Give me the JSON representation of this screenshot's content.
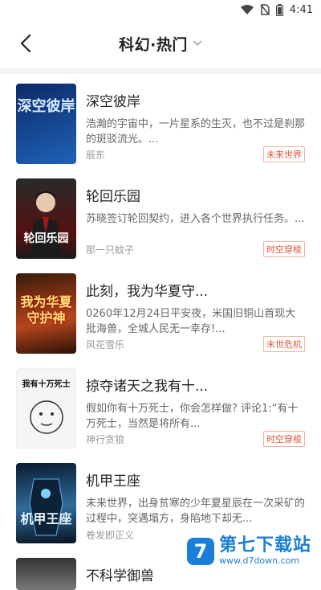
{
  "status": {
    "time": "4:41"
  },
  "header": {
    "title": "科幻·热门"
  },
  "books": [
    {
      "title": "深空彼岸",
      "desc": "浩瀚的宇宙中，一片星系的生灭，也不过是刹那的斑驳流光。...",
      "author": "辰东",
      "tag": "未来世界",
      "cover_text": "深空彼岸",
      "cover_colors": [
        "#0c2a66",
        "#1f62b8"
      ]
    },
    {
      "title": "轮回乐园",
      "desc": "苏晓签订轮回契约，进入各个世界执行任务。...",
      "author": "那一只蚊子",
      "tag": "时空穿梭",
      "cover_text": "轮回乐园",
      "cover_colors": [
        "#1b1b1b",
        "#7a1010"
      ]
    },
    {
      "title": "此刻，我为华夏守...",
      "desc": "0260年12月24日平安夜，米国旧铜山首现大批海兽，全城人民无一幸存!...",
      "author": "风花雪乐",
      "tag": "末世危机",
      "cover_text": "我为华夏守护神",
      "cover_colors": [
        "#3a1a0a",
        "#b8461c"
      ]
    },
    {
      "title": "掠夺诸天之我有十...",
      "desc": "假如你有十万死士，你会怎样做? 评论1:“有十万死士，当然是将所有...",
      "author": "神行贪狼",
      "tag": "时空穿梭",
      "cover_text": "我有十万死士",
      "cover_colors": [
        "#f4f4f4",
        "#e6e6e6"
      ]
    },
    {
      "title": "机甲王座",
      "desc": "未来世界，出身贫寒的少年夏星辰在一次采矿的过程中，突遇塌方，身陷地下却无...",
      "author": "卷发即正义",
      "tag": "",
      "cover_text": "机甲王座",
      "cover_colors": [
        "#0a1c30",
        "#2f6c9c"
      ]
    },
    {
      "title": "不科学御兽",
      "desc": "",
      "author": "",
      "tag": "",
      "cover_text": "",
      "cover_colors": [
        "#444",
        "#888"
      ]
    }
  ],
  "watermark": {
    "main": "第七下载站",
    "url": "www.d7down.com",
    "logo": "7"
  }
}
